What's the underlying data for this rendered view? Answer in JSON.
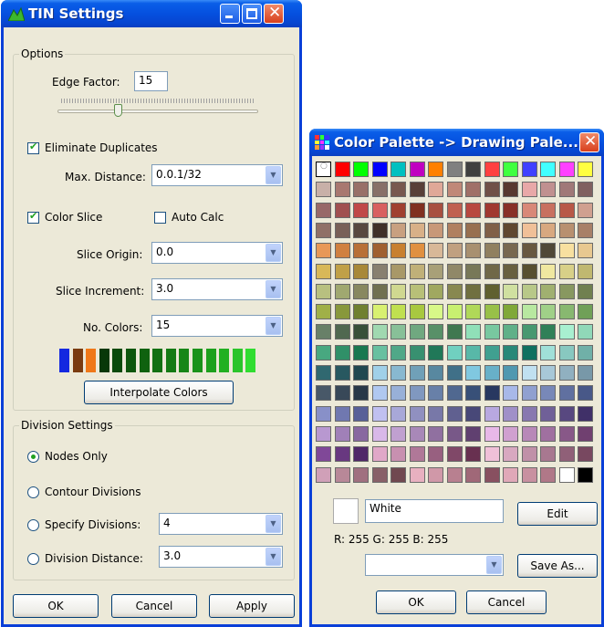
{
  "tin": {
    "title": "TIN Settings",
    "options_label": "Options",
    "edge_factor_label": "Edge Factor:",
    "edge_factor_value": "15",
    "slider_value": 0.3,
    "eliminate_duplicates_label": "Eliminate Duplicates",
    "eliminate_duplicates_checked": true,
    "max_distance_label": "Max. Distance:",
    "max_distance_value": "0.0.1/32",
    "color_slice_label": "Color Slice",
    "color_slice_checked": true,
    "auto_calc_label": "Auto Calc",
    "auto_calc_checked": false,
    "slice_origin_label": "Slice Origin:",
    "slice_origin_value": "0.0",
    "slice_increment_label": "Slice Increment:",
    "slice_increment_value": "3.0",
    "no_colors_label": "No. Colors:",
    "no_colors_value": "15",
    "color_chips": [
      "#1428e0",
      "#7a3b10",
      "#f07818",
      "#083808",
      "#0a4a0a",
      "#0d560d",
      "#0f620f",
      "#127012",
      "#147a14",
      "#178617",
      "#1a921a",
      "#1da01d",
      "#22b022",
      "#2ac42a",
      "#30dd30"
    ],
    "interpolate_label": "Interpolate Colors",
    "division_label": "Division Settings",
    "nodes_only_label": "Nodes Only",
    "contour_divisions_label": "Contour Divisions",
    "specify_divisions_label": "Specify Divisions:",
    "specify_divisions_value": "4",
    "division_distance_label": "Division Distance:",
    "division_distance_value": "3.0",
    "selected_division": "nodes_only",
    "ok_label": "OK",
    "cancel_label": "Cancel",
    "apply_label": "Apply"
  },
  "palette": {
    "title": "Color Palette -> Drawing Pale...",
    "selected_name": "White",
    "rgb_text": "R: 255  G: 255  B: 255",
    "edit_label": "Edit",
    "save_as_label": "Save As...",
    "ok_label": "OK",
    "cancel_label": "Cancel",
    "rows": [
      [
        "#ffffff",
        "#ff0000",
        "#00ff00",
        "#0000ff",
        "#00c0c0",
        "#c000c0",
        "#ff8000",
        "#808080",
        "#404040",
        "#ff4040",
        "#40ff40",
        "#4040ff",
        "#40ffff",
        "#ff40ff",
        "#ffff40"
      ],
      [
        "#c8b0a8",
        "#a87870",
        "#987068",
        "#887068",
        "#785850",
        "#584038",
        "#e0a898",
        "#c08878",
        "#a07068",
        "#705048",
        "#583830",
        "#e8a8a8",
        "#c09090",
        "#a07878",
        "#806060"
      ],
      [
        "#986868",
        "#a05050",
        "#c04848",
        "#d86060",
        "#a04030",
        "#803020",
        "#a85040",
        "#c06050",
        "#b84840",
        "#a03830",
        "#883028",
        "#d88878",
        "#c87060",
        "#b85848",
        "#d0a090"
      ],
      [
        "#907068",
        "#786058",
        "#584840",
        "#403028",
        "#c8a080",
        "#d8b088",
        "#c89878",
        "#b08060",
        "#987050",
        "#806048",
        "#604830",
        "#f0c098",
        "#d8a880",
        "#b89070",
        "#a88068"
      ],
      [
        "#e89858",
        "#d08040",
        "#b87038",
        "#a06030",
        "#c88030",
        "#e09040",
        "#d8b898",
        "#c0a080",
        "#a89070",
        "#908060",
        "#786850",
        "#685840",
        "#504838",
        "#f8e0a0",
        "#e8c890"
      ],
      [
        "#d8b858",
        "#c0a048",
        "#a88838",
        "#888070",
        "#a89868",
        "#c0b078",
        "#a8a078",
        "#908868",
        "#787858",
        "#706848",
        "#686040",
        "#585030",
        "#f0e8a0",
        "#d8d088",
        "#c0b870"
      ],
      [
        "#b8c080",
        "#a0a870",
        "#888860",
        "#707050",
        "#d0d890",
        "#b8c078",
        "#a0a860",
        "#888850",
        "#707040",
        "#606030",
        "#d0e0a0",
        "#b8c888",
        "#a0b070",
        "#889860",
        "#708050"
      ],
      [
        "#a0b048",
        "#88983c",
        "#708030",
        "#d8f070",
        "#c0e050",
        "#a8c840",
        "#d8f888",
        "#c8f070",
        "#b0d858",
        "#98c048",
        "#80a838",
        "#b8e8a0",
        "#a0d088",
        "#88b870",
        "#70a058"
      ],
      [
        "#688068",
        "#506850",
        "#385038",
        "#a0d8b0",
        "#88c098",
        "#70a880",
        "#589068",
        "#407850",
        "#90e0b8",
        "#78c8a0",
        "#60b088",
        "#489870",
        "#308058",
        "#a8f0d0",
        "#90d8b8"
      ],
      [
        "#48a880",
        "#309068",
        "#187850",
        "#68c0a0",
        "#50a888",
        "#389070",
        "#207858",
        "#70d0c0",
        "#58b8a8",
        "#40a090",
        "#288878",
        "#107060",
        "#a0e0d8",
        "#88c8c0",
        "#70b0a8"
      ],
      [
        "#306870",
        "#285860",
        "#204850",
        "#a0d0e8",
        "#88b8d0",
        "#70a0b8",
        "#5888a0",
        "#407088",
        "#80c8e0",
        "#68b0c8",
        "#5098b0",
        "#c0e0f0",
        "#a8c8d8",
        "#90b0c0",
        "#7898a8"
      ],
      [
        "#485868",
        "#384858",
        "#283848",
        "#b0c8f0",
        "#98b0d8",
        "#8098c0",
        "#6880a8",
        "#506890",
        "#385078",
        "#283860",
        "#a8b8e8",
        "#90a0d0",
        "#7888b8",
        "#6070a0",
        "#485888"
      ],
      [
        "#8890c8",
        "#7078b0",
        "#586098",
        "#c0c0f0",
        "#a8a8d8",
        "#9090c0",
        "#7878a8",
        "#606090",
        "#484878",
        "#b8a8e0",
        "#a090c8",
        "#8878b0",
        "#706098",
        "#584880",
        "#403068"
      ],
      [
        "#b898d0",
        "#a080b8",
        "#8868a0",
        "#d8b8e8",
        "#c0a0d0",
        "#a888b8",
        "#9070a0",
        "#785888",
        "#604070",
        "#e8b8e8",
        "#d0a0d0",
        "#b888b8",
        "#a070a0",
        "#885888",
        "#704070"
      ],
      [
        "#804898",
        "#683880",
        "#502868",
        "#e0a8c8",
        "#c890b0",
        "#b07898",
        "#986080",
        "#804868",
        "#683050",
        "#f0c0d8",
        "#d8a8c0",
        "#c090a8",
        "#a87890",
        "#906078",
        "#784860"
      ],
      [
        "#d0a0b8",
        "#b88898",
        "#a07080",
        "#886068",
        "#704850",
        "#e8b0c0",
        "#d098a8",
        "#b88090",
        "#a06878",
        "#885060",
        "#e0a8b8",
        "#c890a0",
        "#b07888",
        "#ffffff",
        "#000000"
      ]
    ]
  }
}
